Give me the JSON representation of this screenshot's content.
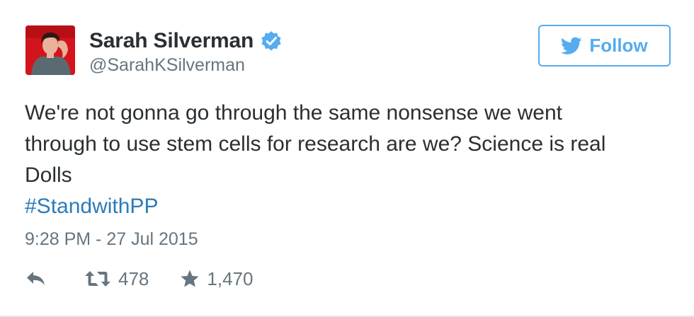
{
  "tweet": {
    "author": {
      "display_name": "Sarah Silverman",
      "handle": "@SarahKSilverman",
      "verified": true,
      "avatar_icon": "profile-photo"
    },
    "follow_button": {
      "label": "Follow",
      "icon": "twitter-bird-icon"
    },
    "text": "We're not gonna go through the same nonsense we went\nthrough to use stem cells for research are we? Science is real\nDolls",
    "hashtag": "#StandwithPP",
    "timestamp": "9:28 PM - 27 Jul 2015",
    "actions": {
      "reply_icon": "reply-icon",
      "retweet_icon": "retweet-icon",
      "retweet_count": "478",
      "favorite_icon": "star-icon",
      "favorite_count": "1,470"
    }
  },
  "colors": {
    "accent": "#55acee",
    "link": "#2b7bb9",
    "text": "#292f33",
    "muted": "#66757f",
    "avatar_bg": "#d4141c"
  }
}
